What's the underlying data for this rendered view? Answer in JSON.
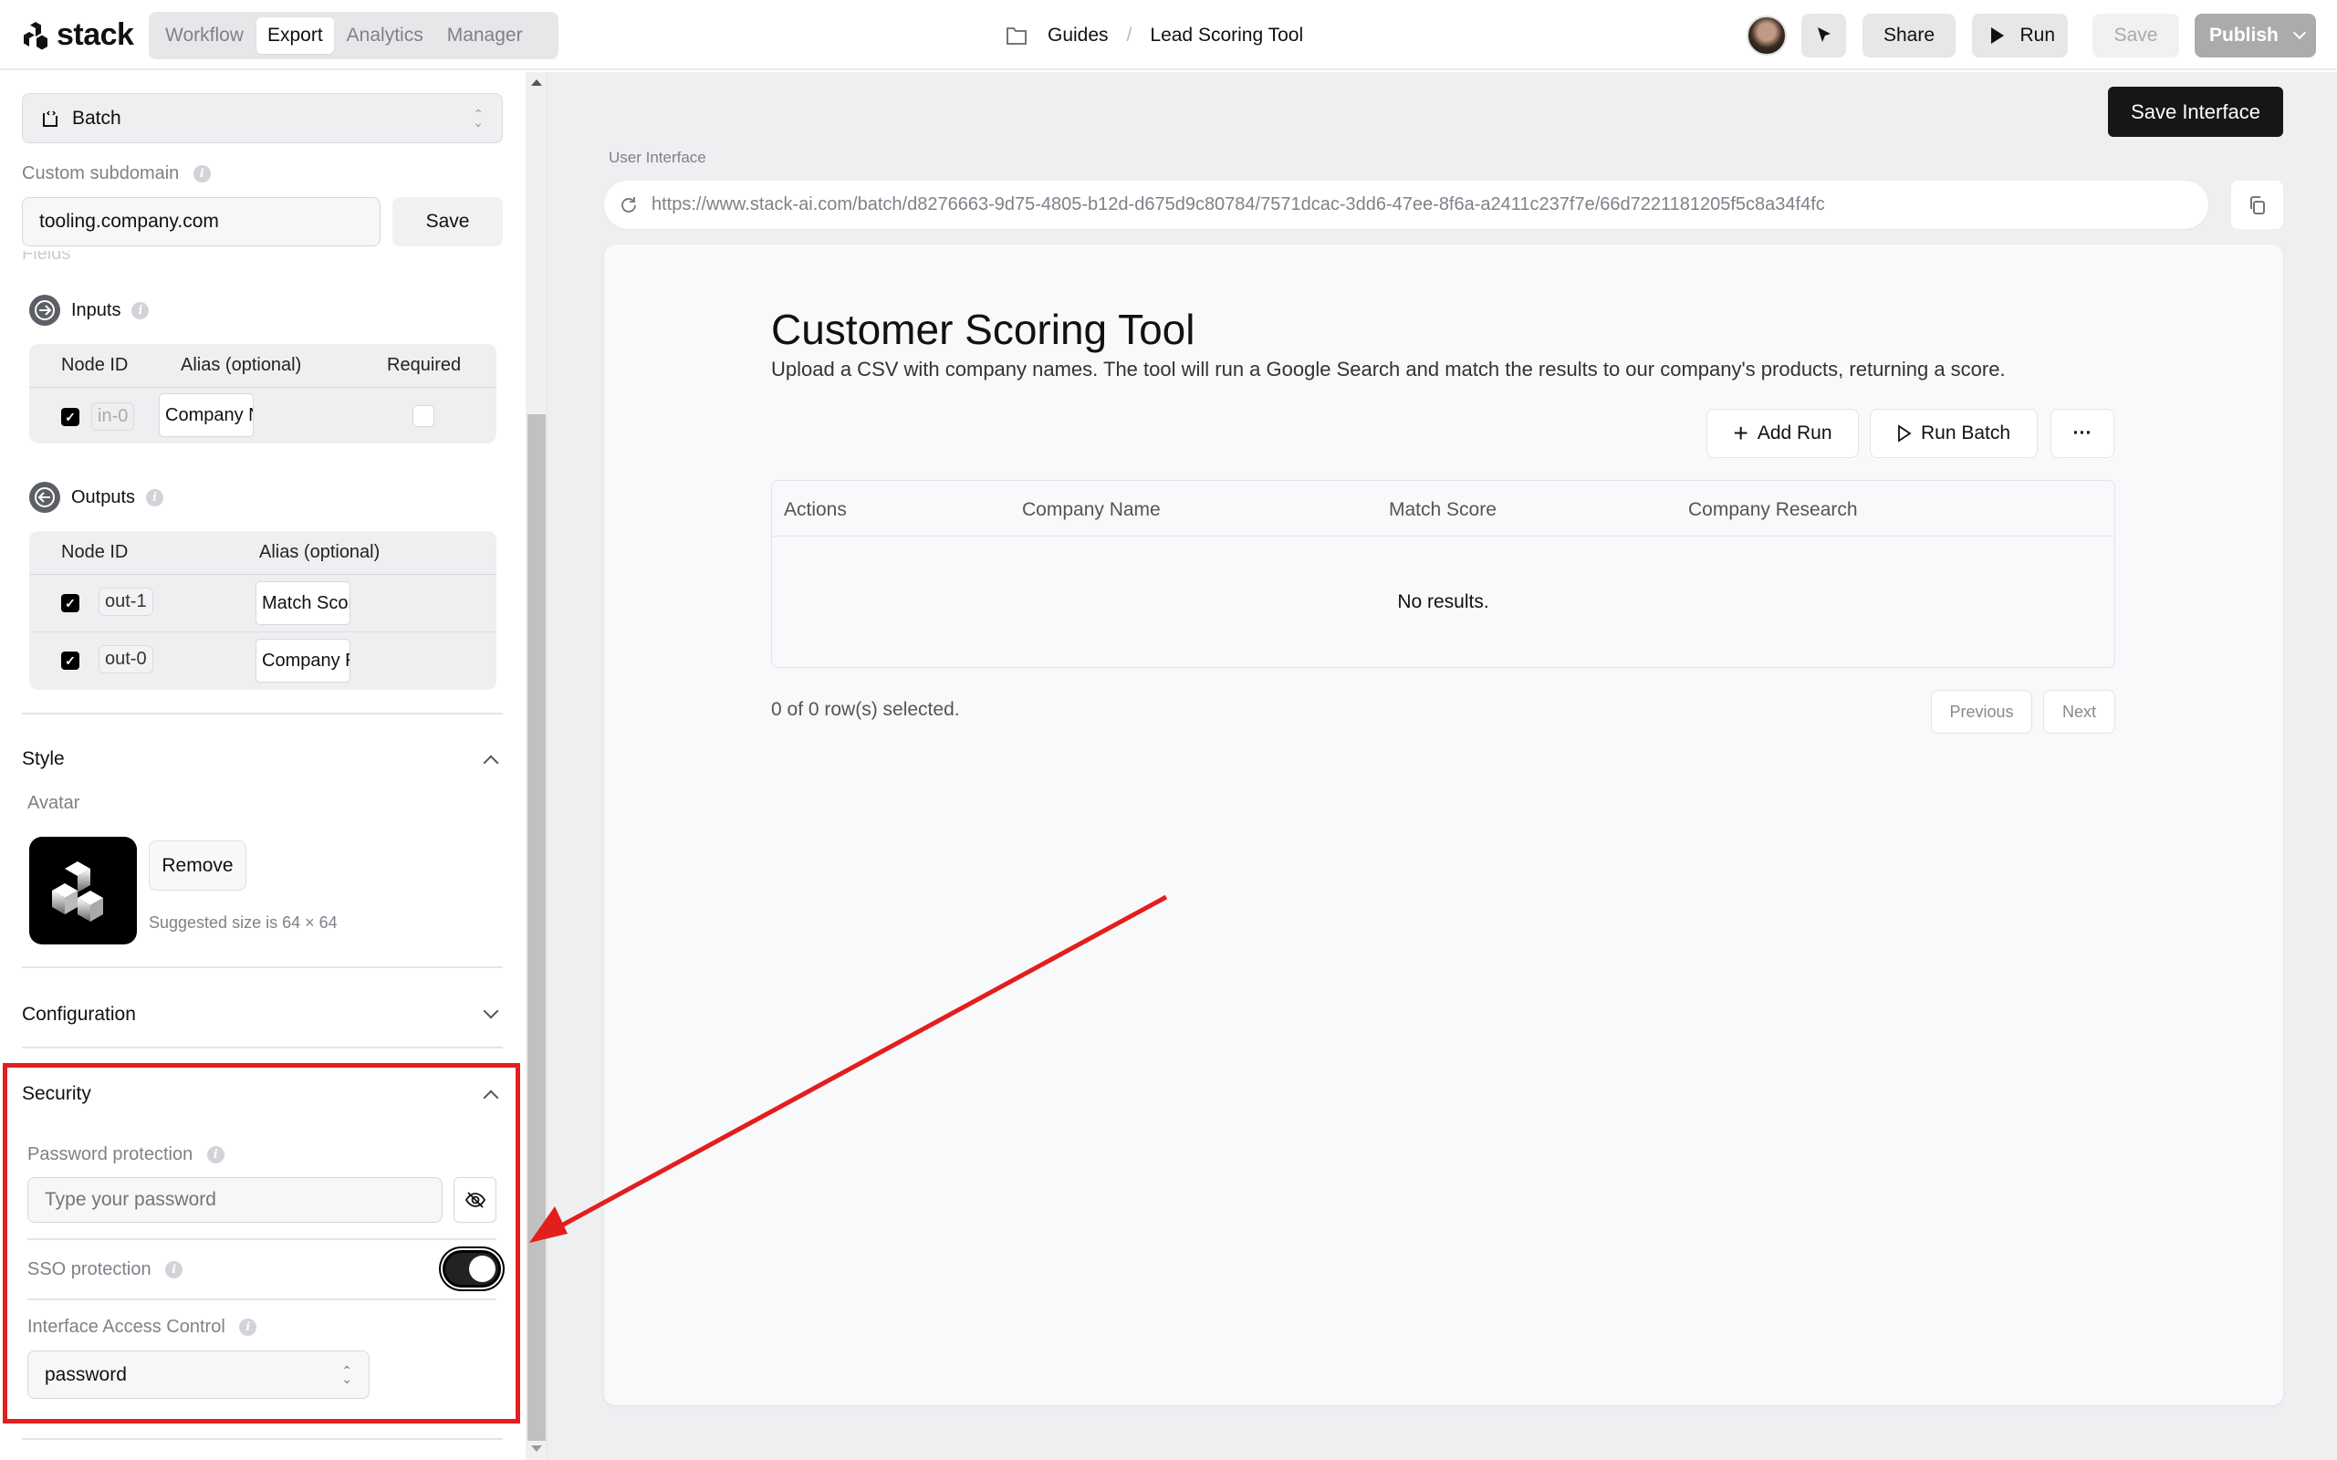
{
  "topbar": {
    "logo_text": "stack",
    "tabs": [
      {
        "label": "Workflow",
        "active": false
      },
      {
        "label": "Export",
        "active": true
      },
      {
        "label": "Analytics",
        "active": false
      },
      {
        "label": "Manager",
        "active": false
      }
    ],
    "breadcrumb": {
      "folder": "Guides",
      "separator": "/",
      "page": "Lead Scoring Tool"
    },
    "buttons": {
      "share": "Share",
      "run": "Run",
      "save": "Save",
      "publish": "Publish"
    }
  },
  "sidebar": {
    "interface_type": "Batch",
    "custom_subdomain": {
      "label": "Custom subdomain",
      "value": "tooling.company.com",
      "save_label": "Save"
    },
    "fields_label": "Fields",
    "inputs": {
      "title": "Inputs",
      "headers": [
        "Node ID",
        "Alias (optional)",
        "Required"
      ],
      "rows": [
        {
          "checked": true,
          "node_id": "in-0",
          "alias": "Company N",
          "required": false
        }
      ]
    },
    "outputs": {
      "title": "Outputs",
      "headers": [
        "Node ID",
        "Alias (optional)"
      ],
      "rows": [
        {
          "checked": true,
          "node_id": "out-1",
          "alias": "Match Scor"
        },
        {
          "checked": true,
          "node_id": "out-0",
          "alias": "Company R"
        }
      ]
    },
    "style": {
      "title": "Style",
      "avatar_label": "Avatar",
      "remove_label": "Remove",
      "size_hint": "Suggested size is 64 × 64"
    },
    "configuration": {
      "title": "Configuration"
    },
    "security": {
      "title": "Security",
      "password_label": "Password protection",
      "password_placeholder": "Type your password",
      "sso_label": "SSO protection",
      "sso_enabled": true,
      "access_label": "Interface Access Control",
      "access_value": "password"
    }
  },
  "main": {
    "save_interface_label": "Save Interface",
    "url_label": "User Interface",
    "url": "https://www.stack-ai.com/batch/d8276663-9d75-4805-b12d-d675d9c80784/7571dcac-3dd6-47ee-8f6a-a2411c237f7e/66d7221181205f5c8a34f4fc",
    "preview": {
      "title": "Customer Scoring Tool",
      "description": "Upload a CSV with company names. The tool will run a Google Search and match the results to our company's products, returning a score.",
      "add_run_label": "Add Run",
      "run_batch_label": "Run Batch",
      "more_label": "···",
      "columns": [
        "Actions",
        "Company Name",
        "Match Score",
        "Company Research"
      ],
      "empty_text": "No results.",
      "selection_text": "0 of 0 row(s) selected.",
      "previous_label": "Previous",
      "next_label": "Next"
    }
  },
  "annotation": {
    "color": "#e31e1e"
  }
}
